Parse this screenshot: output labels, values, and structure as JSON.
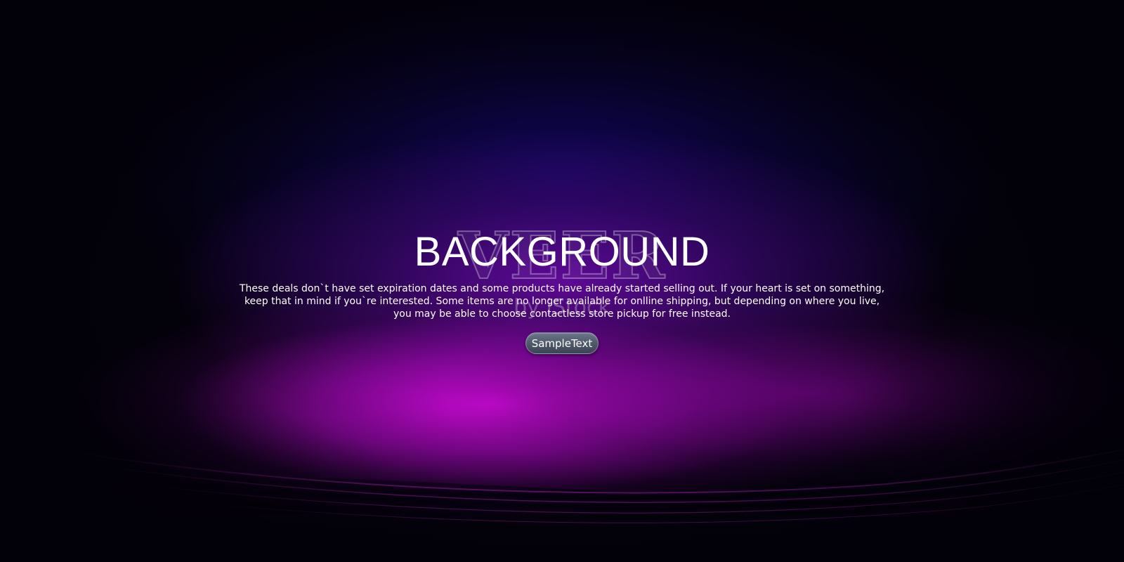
{
  "hero": {
    "title": "BACKGROUND",
    "body": "These deals don`t have set expiration dates and some products have already started selling out. If your  heart is set on  something, keep that  in mind if    you`re interested. Some items are no longer available for onlline shipping, but depending on where you live, you may be able to choose contactless store pickup for free instead.",
    "button_label": "SampleText"
  },
  "watermark": {
    "brand": "VEER",
    "byline": "by iStock"
  },
  "colors": {
    "background_base": "#03010a",
    "deep_navy": "#10065a",
    "violet": "#6e0aaa",
    "magenta": "#cd0ad7",
    "text": "#ffffff",
    "button_fill": "#4f5a6b"
  }
}
